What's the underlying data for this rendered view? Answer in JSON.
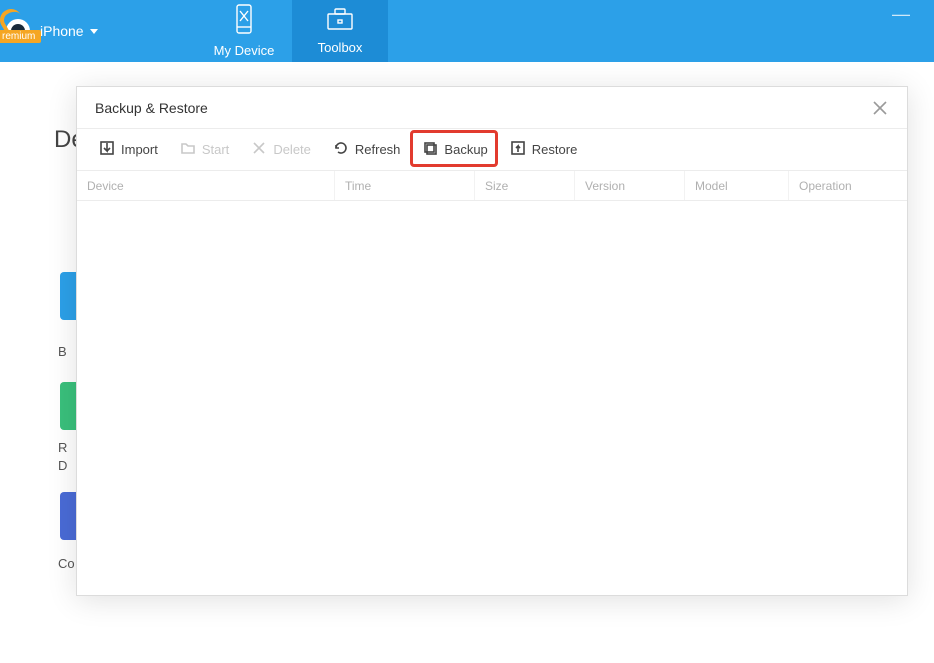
{
  "topbar": {
    "premium_badge": "remium",
    "device_name": "iPhone",
    "tabs": {
      "my_device": "My Device",
      "toolbox": "Toolbox"
    }
  },
  "background": {
    "title_fragment": "De",
    "labels": {
      "b": "B",
      "r": "R",
      "d": "D",
      "co": "Co"
    }
  },
  "dialog": {
    "title": "Backup & Restore",
    "toolbar": {
      "import": "Import",
      "start": "Start",
      "delete": "Delete",
      "refresh": "Refresh",
      "backup": "Backup",
      "restore": "Restore"
    },
    "columns": {
      "device": "Device",
      "time": "Time",
      "size": "Size",
      "version": "Version",
      "model": "Model",
      "operation": "Operation"
    },
    "rows": []
  },
  "highlight": {
    "target": "backup-button"
  }
}
